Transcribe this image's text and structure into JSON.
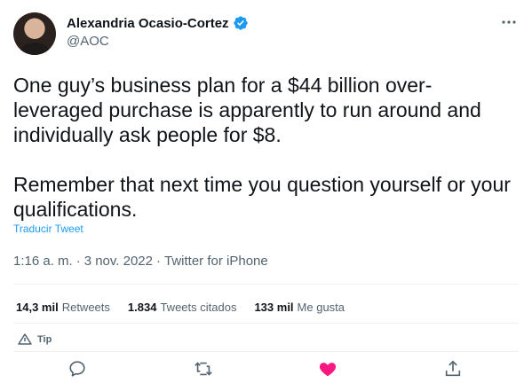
{
  "author": {
    "display_name": "Alexandria Ocasio-Cortez",
    "handle": "@AOC",
    "verified_icon": "verified-badge-icon",
    "verified_color": "#1d9bf0"
  },
  "tweet": {
    "text": "One guy’s business plan for a $44 billion over-leveraged purchase is apparently to run around and individually ask people for $8.\n\nRemember that next time you question yourself or your qualifications.",
    "translate_label": "Traducir Tweet",
    "time": "1:16 a. m.",
    "separator": "·",
    "date": "3 nov. 2022",
    "source": "Twitter for iPhone"
  },
  "stats": {
    "retweets_count": "14,3 mil",
    "retweets_label": "Retweets",
    "quotes_count": "1.834",
    "quotes_label": "Tweets citados",
    "likes_count": "133 mil",
    "likes_label": "Me gusta"
  },
  "tip": {
    "label": "Tip"
  },
  "actions": {
    "reply_icon": "reply-icon",
    "retweet_icon": "retweet-icon",
    "like_icon": "heart-filled-icon",
    "share_icon": "share-icon",
    "like_color": "#f91880"
  },
  "colors": {
    "text_primary": "#0f1419",
    "text_secondary": "#536471",
    "link": "#1d9bf0",
    "divider": "#eff3f4"
  }
}
